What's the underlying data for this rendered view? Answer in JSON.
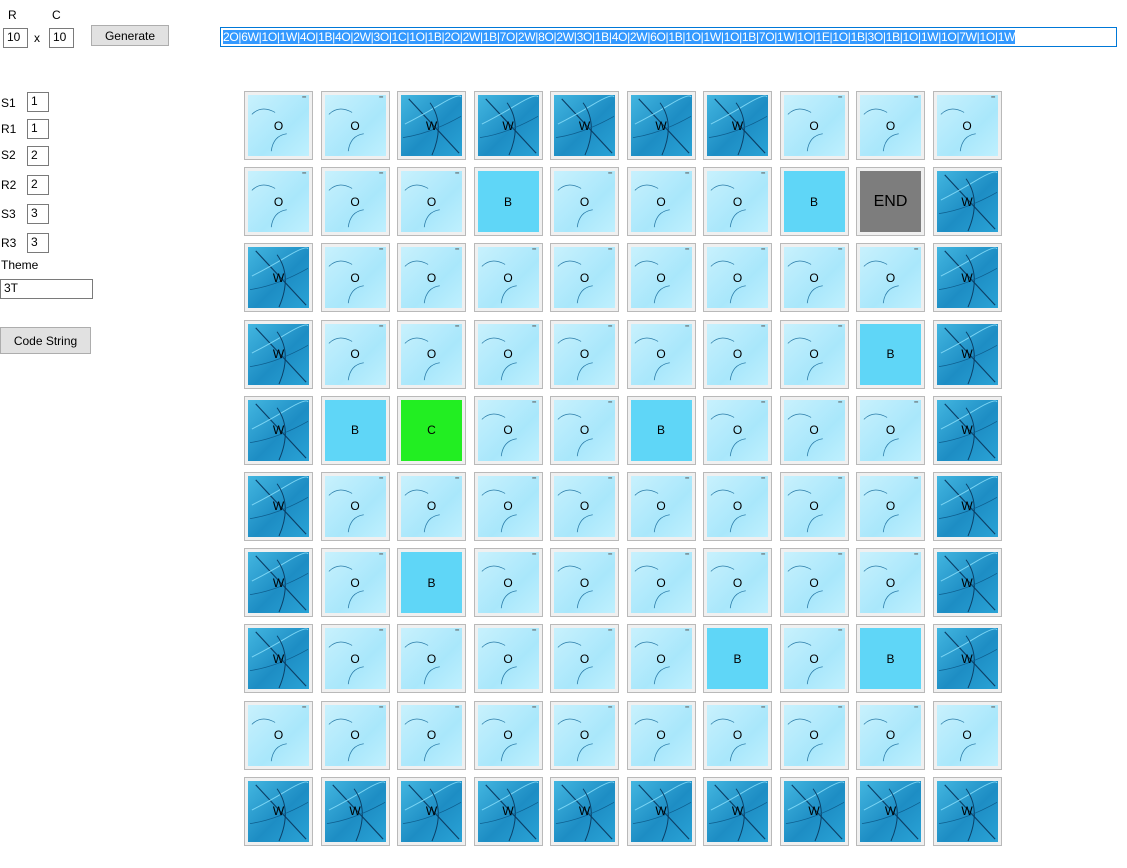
{
  "controls": {
    "rows_label": "R",
    "cols_label": "C",
    "rows_value": "10",
    "cols_value": "10",
    "times_label": "x",
    "generate_label": "Generate",
    "s1_label": "S1",
    "s1_value": "1",
    "r1_label": "R1",
    "r1_value": "1",
    "s2_label": "S2",
    "s2_value": "2",
    "r2_label": "R2",
    "r2_value": "2",
    "s3_label": "S3",
    "s3_value": "3",
    "r3_label": "R3",
    "r3_value": "3",
    "theme_label": "Theme",
    "theme_value": "3T",
    "code_string_button": "Code String"
  },
  "code_string": "2O|6W|1O|1W|4O|1B|4O|2W|3O|1C|1O|1B|2O|2W|1B|7O|2W|8O|2W|3O|1B|4O|2W|6O|1B|1O|1W|1O|1B|7O|1W|1O|1E|1O|1B|3O|1B|1O|1W|1O|7W|1O|1W",
  "grid": {
    "rows": [
      [
        "O",
        "O",
        "W",
        "W",
        "W",
        "W",
        "W",
        "O",
        "O",
        "O"
      ],
      [
        "O",
        "O",
        "O",
        "B",
        "O",
        "O",
        "O",
        "B",
        "END",
        "W"
      ],
      [
        "W",
        "O",
        "O",
        "O",
        "O",
        "O",
        "O",
        "O",
        "O",
        "W"
      ],
      [
        "W",
        "O",
        "O",
        "O",
        "O",
        "O",
        "O",
        "O",
        "B",
        "W"
      ],
      [
        "W",
        "B",
        "C",
        "O",
        "O",
        "B",
        "O",
        "O",
        "O",
        "W"
      ],
      [
        "W",
        "O",
        "O",
        "O",
        "O",
        "O",
        "O",
        "O",
        "O",
        "W"
      ],
      [
        "W",
        "O",
        "B",
        "O",
        "O",
        "O",
        "O",
        "O",
        "O",
        "W"
      ],
      [
        "W",
        "O",
        "O",
        "O",
        "O",
        "O",
        "B",
        "O",
        "B",
        "W"
      ],
      [
        "O",
        "O",
        "O",
        "O",
        "O",
        "O",
        "O",
        "O",
        "O",
        "O"
      ],
      [
        "W",
        "W",
        "W",
        "W",
        "W",
        "W",
        "W",
        "W",
        "W",
        "W"
      ]
    ]
  },
  "colors": {
    "wall": "#1d8dc4",
    "open": "#b6ecfc",
    "box": "#5fd6f7",
    "current": "#22ee22",
    "end": "#7d7d7d",
    "selection": "#3399ff"
  }
}
